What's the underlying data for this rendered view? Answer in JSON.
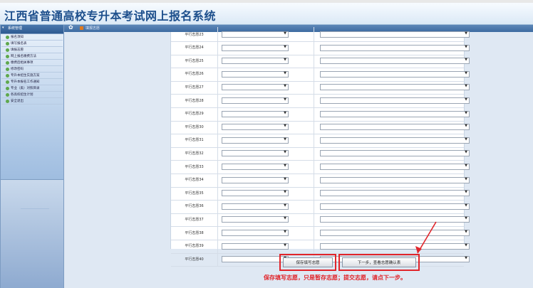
{
  "header": {
    "title": "江西省普通高校专升本考试网上报名系统"
  },
  "sidebar": {
    "head": "系统管理",
    "items": [
      {
        "label": "报名须知"
      },
      {
        "label": "填写报名表"
      },
      {
        "label": "填报志愿"
      },
      {
        "label": "网上报名缴费方法"
      },
      {
        "label": "缴费后相关事项"
      },
      {
        "label": "修改密码"
      },
      {
        "label": "专升本招生实施方案"
      },
      {
        "label": "专升本报名工作通知"
      },
      {
        "label": "专业（类）对照目录"
      },
      {
        "label": "各高校招生计划"
      },
      {
        "label": "安全退出"
      }
    ]
  },
  "breadcrumb": {
    "text": "填报志愿"
  },
  "form": {
    "rows": [
      {
        "label": "平行志愿23"
      },
      {
        "label": "平行志愿24"
      },
      {
        "label": "平行志愿25"
      },
      {
        "label": "平行志愿26"
      },
      {
        "label": "平行志愿27"
      },
      {
        "label": "平行志愿28"
      },
      {
        "label": "平行志愿29"
      },
      {
        "label": "平行志愿30"
      },
      {
        "label": "平行志愿31"
      },
      {
        "label": "平行志愿32"
      },
      {
        "label": "平行志愿33"
      },
      {
        "label": "平行志愿34"
      },
      {
        "label": "平行志愿35"
      },
      {
        "label": "平行志愿36"
      },
      {
        "label": "平行志愿37"
      },
      {
        "label": "平行志愿38"
      },
      {
        "label": "平行志愿39"
      },
      {
        "label": "平行志愿40"
      }
    ],
    "dropdown_arrow": "▼"
  },
  "buttons": {
    "save": "保存填写志愿",
    "next": "下一步，查看志愿确认表"
  },
  "annotation": {
    "note": "保存填写志愿，只是暂存志愿；提交志愿，请点下一步。"
  },
  "colors": {
    "highlight": "#e1242a",
    "brand": "#1d4f8c"
  }
}
